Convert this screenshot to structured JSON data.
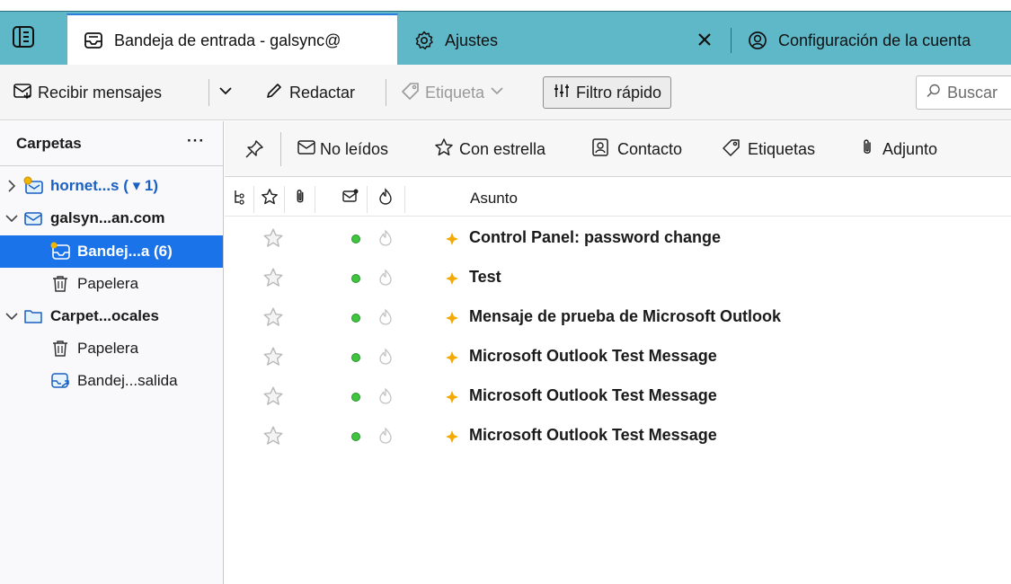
{
  "tabs": {
    "active": {
      "label": "Bandeja de entrada - galsync@",
      "icon": "inbox-icon"
    },
    "settings": {
      "label": "Ajustes",
      "icon": "gear-icon"
    },
    "account": {
      "label": "Configuración de la cuenta",
      "icon": "account-icon"
    }
  },
  "toolbar": {
    "get_messages": "Recibir mensajes",
    "write": "Redactar",
    "tag": "Etiqueta",
    "quick_filter": "Filtro rápido",
    "search_placeholder": "Buscar"
  },
  "folder_pane": {
    "header": "Carpetas",
    "menu": "···",
    "folders": [
      {
        "label": "hornet...s ( ▾ 1)",
        "icon": "server-icon"
      },
      {
        "label": "galsyn...an.com",
        "icon": "mail-account-icon"
      },
      {
        "label": "Bandej...a (6)",
        "icon": "inbox-icon"
      },
      {
        "label": "Papelera",
        "icon": "trash-icon"
      },
      {
        "label": "Carpet...ocales",
        "icon": "folder-icon"
      },
      {
        "label": "Papelera",
        "icon": "trash-icon"
      },
      {
        "label": "Bandej...salida",
        "icon": "outbox-icon"
      }
    ]
  },
  "quick_filter_bar": {
    "unread": "No leídos",
    "starred": "Con estrella",
    "contact": "Contacto",
    "tags": "Etiquetas",
    "attachment": "Adjunto"
  },
  "columns": {
    "subject": "Asunto"
  },
  "messages": [
    {
      "subject": "Control Panel: password change"
    },
    {
      "subject": "Test"
    },
    {
      "subject": "Mensaje de prueba de Microsoft Outlook"
    },
    {
      "subject": "Microsoft Outlook Test Message"
    },
    {
      "subject": "Microsoft Outlook Test Message"
    },
    {
      "subject": "Microsoft Outlook Test Message"
    }
  ],
  "colors": {
    "tab_bar": "#5fb8c8",
    "selection": "#1a73e8",
    "unread_dot": "#3ec63e",
    "new_indicator": "#f2a900",
    "account_accent": "#1a5fc2"
  }
}
